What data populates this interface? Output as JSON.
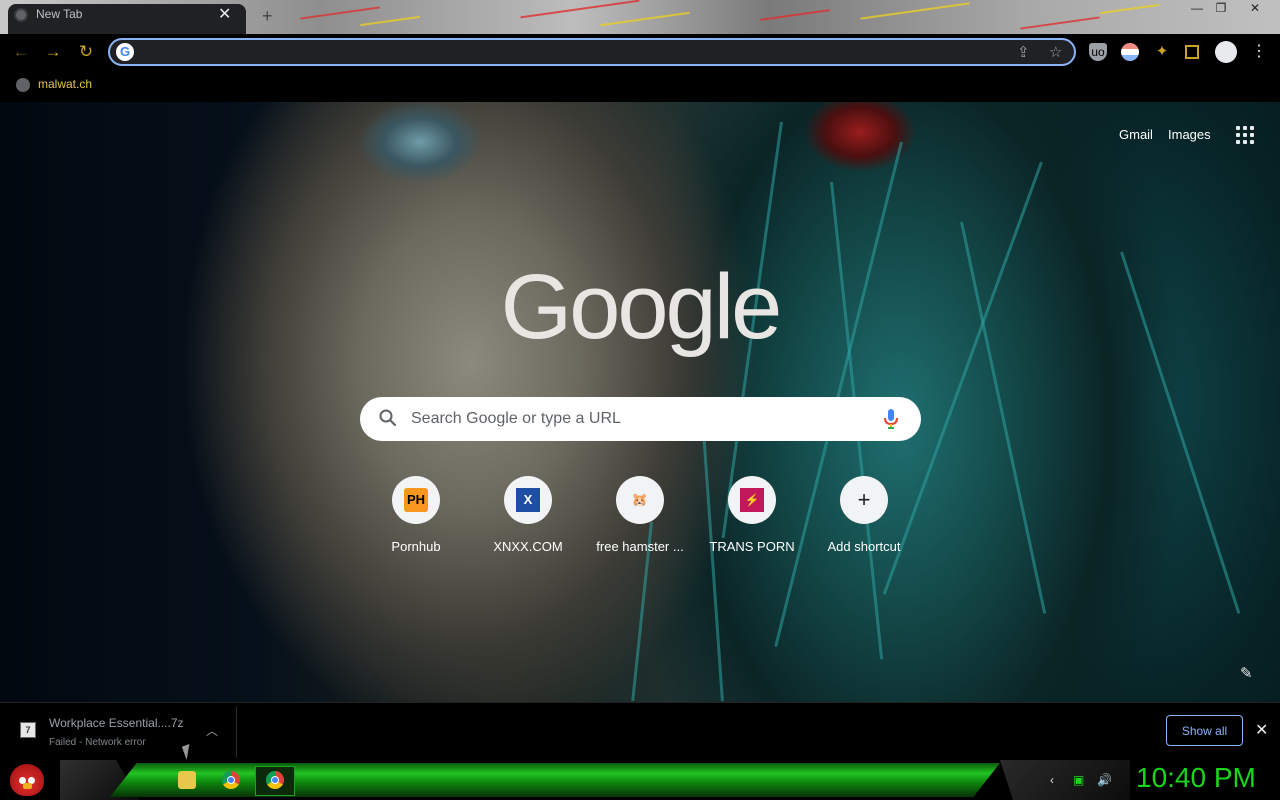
{
  "tab": {
    "title": "New Tab",
    "close": "✕",
    "new_tab": "+"
  },
  "window_controls": {
    "minimize": "—",
    "restore": "❐",
    "close": "✕"
  },
  "nav": {
    "back": "←",
    "forward": "→",
    "reload": "↻"
  },
  "omnibox": {
    "value": "",
    "share": "⇪",
    "star": "☆"
  },
  "extensions": {
    "ublock": "uo",
    "menu": "⋮"
  },
  "bookmarks": [
    {
      "label": "malwat.ch"
    }
  ],
  "ntp": {
    "gmail": "Gmail",
    "images": "Images",
    "logo": "Google",
    "search_placeholder": "Search Google or type a URL",
    "shortcuts": [
      {
        "label": "Pornhub",
        "icon": "PH"
      },
      {
        "label": "XNXX.COM",
        "icon": "X"
      },
      {
        "label": "free hamster ...",
        "icon": "🐹"
      },
      {
        "label": "TRANS PORN",
        "icon": "⚡"
      },
      {
        "label": "Add shortcut",
        "icon": "+"
      }
    ],
    "edit_icon": "✎"
  },
  "download": {
    "filename": "Workplace Essential....7z",
    "status": "Failed - Network error",
    "chevron": "︿",
    "icon": "7",
    "show_all": "Show all",
    "close": "✕"
  },
  "taskbar": {
    "clock": "10:40 PM",
    "tray_icons": [
      "‹",
      "▣",
      "🔊"
    ]
  },
  "colors": {
    "accent": "#8ab4f8",
    "nav_icons": "#c9a227",
    "bookmark_text": "#e6c44a",
    "clock": "#19d619",
    "taskbar_green": "#22c422"
  }
}
